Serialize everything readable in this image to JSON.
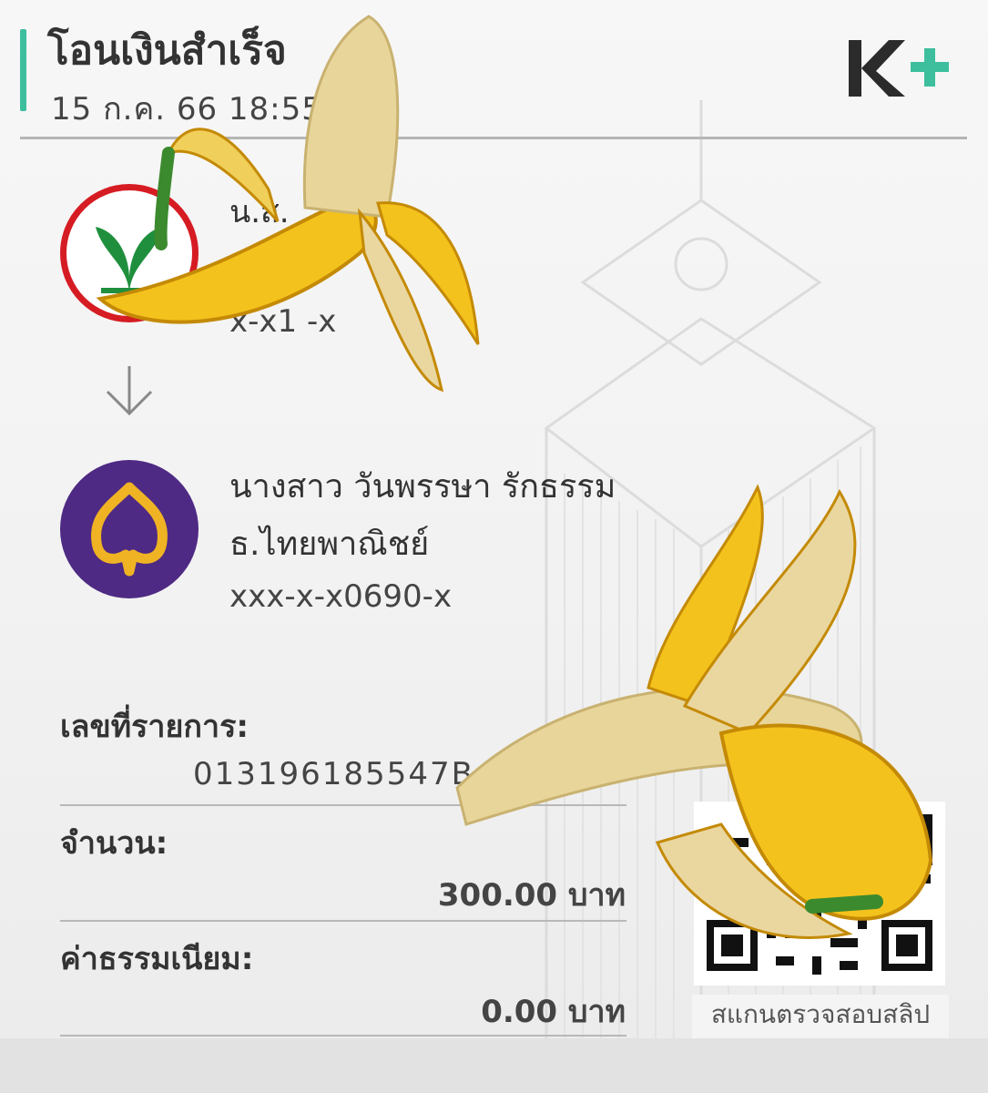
{
  "slip": {
    "title": "โอนเงินสำเร็จ",
    "datetime": "15 ก.ค. 66  18:55",
    "brand_logo": "K+",
    "brand_color": "#3dbf9d"
  },
  "sender": {
    "name": "น.ส.",
    "account": "x-x1      -x",
    "bank_logo_icon": "kasikorn-bank-icon"
  },
  "receiver": {
    "name": "นางสาว วันพรรษา รักธรรม",
    "bank": "ธ.ไทยพาณิชย์",
    "account": "xxx-x-x0690-x",
    "bank_logo_icon": "scb-bank-icon"
  },
  "details": {
    "reference_label": "เลขที่รายการ:",
    "reference_value": "013196185547B",
    "amount_label": "จำนวน:",
    "amount_value": "300.00 บาท",
    "fee_label": "ค่าธรรมเนียม:",
    "fee_value": "0.00 บาท"
  },
  "qr": {
    "caption": "สแกนตรวจสอบสลิป"
  },
  "colors": {
    "kasikorn_red": "#d61c23",
    "kasikorn_green": "#1f8f3d",
    "scb_purple": "#4e2a84",
    "scb_gold": "#f0b323",
    "banana_yellow": "#f4c21c"
  }
}
